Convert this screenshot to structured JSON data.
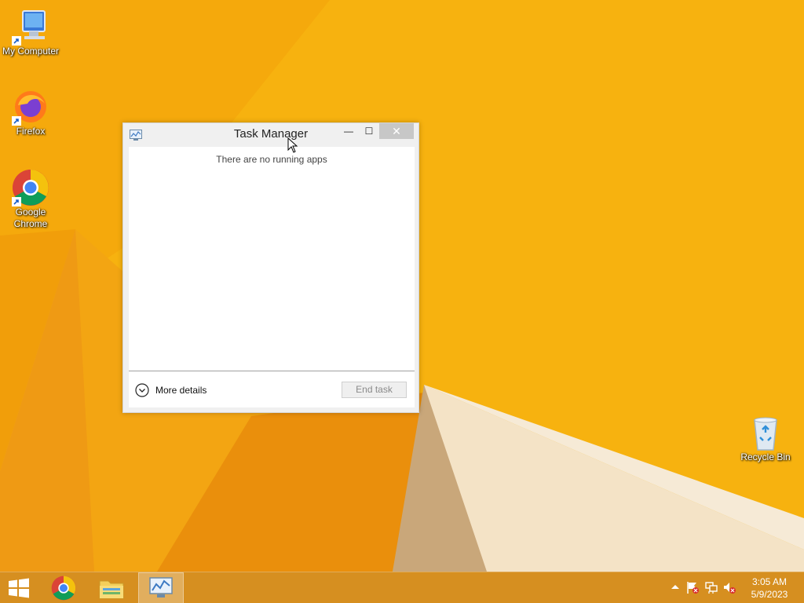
{
  "desktop": {
    "icons": [
      {
        "label": "My Computer",
        "icon": "computer-icon"
      },
      {
        "label": "Firefox",
        "icon": "firefox-icon"
      },
      {
        "label": "Google Chrome",
        "icon": "chrome-icon"
      },
      {
        "label": "Recycle Bin",
        "icon": "recycle-bin-icon"
      }
    ],
    "wallpaper_colors": {
      "base": "#f7b20f",
      "dark": "#e8920a",
      "light": "#f6e6c8"
    }
  },
  "task_manager": {
    "title": "Task Manager",
    "empty_message": "There are no running apps",
    "more_details_label": "More details",
    "end_task_label": "End task",
    "close_glyph": "✕",
    "minimize_glyph": "—",
    "maximize_glyph": "☐"
  },
  "taskbar": {
    "pinned": [
      {
        "name": "start",
        "icon": "windows-logo-icon"
      },
      {
        "name": "chrome",
        "icon": "chrome-icon"
      },
      {
        "name": "file-explorer",
        "icon": "folder-icon"
      },
      {
        "name": "task-manager",
        "icon": "task-manager-icon",
        "active": true
      }
    ],
    "tray_icons": [
      "show-hidden-icons-icon",
      "action-center-flag-icon",
      "network-icon",
      "volume-muted-icon"
    ],
    "clock": {
      "time": "3:05 AM",
      "date": "5/9/2023"
    }
  }
}
